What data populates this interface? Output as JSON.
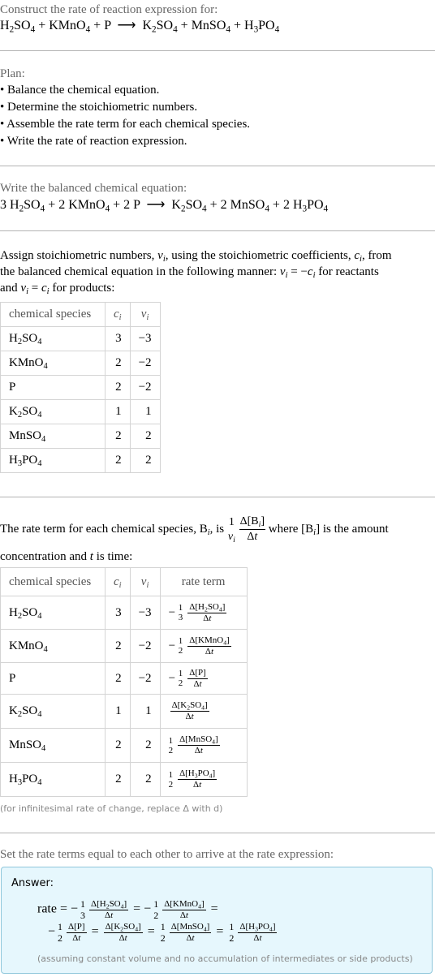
{
  "intro": {
    "heading": "Construct the rate of reaction expression for:",
    "reaction": {
      "reactants": [
        "H2SO4",
        "KMnO4",
        "P"
      ],
      "products": [
        "K2SO4",
        "MnSO4",
        "H3PO4"
      ],
      "arrow": "⟶"
    }
  },
  "plan": {
    "heading": "Plan:",
    "steps": [
      "• Balance the chemical equation.",
      "• Determine the stoichiometric numbers.",
      "• Assemble the rate term for each chemical species.",
      "• Write the rate of reaction expression."
    ]
  },
  "balanced": {
    "heading": "Write the balanced chemical equation:",
    "equation": "3 H2SO4 + 2 KMnO4 + 2 P ⟶ K2SO4 + 2 MnSO4 + 2 H3PO4"
  },
  "stoich": {
    "text_line1": "Assign stoichiometric numbers, νi, using the stoichiometric coefficients, ci, from",
    "text_line2": "the balanced chemical equation in the following manner: νi = −ci for reactants",
    "text_line3": "and νi = ci for products:",
    "headers": [
      "chemical species",
      "ci",
      "νi"
    ],
    "rows": [
      {
        "species": "H2SO4",
        "c": "3",
        "v": "−3"
      },
      {
        "species": "KMnO4",
        "c": "2",
        "v": "−2"
      },
      {
        "species": "P",
        "c": "2",
        "v": "−2"
      },
      {
        "species": "K2SO4",
        "c": "1",
        "v": "1"
      },
      {
        "species": "MnSO4",
        "c": "2",
        "v": "2"
      },
      {
        "species": "H3PO4",
        "c": "2",
        "v": "2"
      }
    ]
  },
  "rate_terms": {
    "text_a": "The rate term for each chemical species, Bi, is",
    "text_b": "where [Bi] is the amount",
    "text_line2": "concentration and t is time:",
    "headers": [
      "chemical species",
      "ci",
      "νi",
      "rate term"
    ],
    "rows": [
      {
        "species": "H2SO4",
        "c": "3",
        "v": "−3",
        "sign": "−",
        "coef": [
          "1",
          "3"
        ],
        "conc": "Δ[H2SO4]",
        "dt": "Δt"
      },
      {
        "species": "KMnO4",
        "c": "2",
        "v": "−2",
        "sign": "−",
        "coef": [
          "1",
          "2"
        ],
        "conc": "Δ[KMnO4]",
        "dt": "Δt"
      },
      {
        "species": "P",
        "c": "2",
        "v": "−2",
        "sign": "−",
        "coef": [
          "1",
          "2"
        ],
        "conc": "Δ[P]",
        "dt": "Δt"
      },
      {
        "species": "K2SO4",
        "c": "1",
        "v": "1",
        "sign": "",
        "coef": null,
        "conc": "Δ[K2SO4]",
        "dt": "Δt"
      },
      {
        "species": "MnSO4",
        "c": "2",
        "v": "2",
        "sign": "",
        "coef": [
          "1",
          "2"
        ],
        "conc": "Δ[MnSO4]",
        "dt": "Δt"
      },
      {
        "species": "H3PO4",
        "c": "2",
        "v": "2",
        "sign": "",
        "coef": [
          "1",
          "2"
        ],
        "conc": "Δ[H3PO4]",
        "dt": "Δt"
      }
    ],
    "footnote": "(for infinitesimal rate of change, replace Δ with d)"
  },
  "final": {
    "heading": "Set the rate terms equal to each other to arrive at the rate expression:",
    "answer_label": "Answer:",
    "rate_word": "rate",
    "note": "(assuming constant volume and no accumulation of intermediates or side products)"
  }
}
